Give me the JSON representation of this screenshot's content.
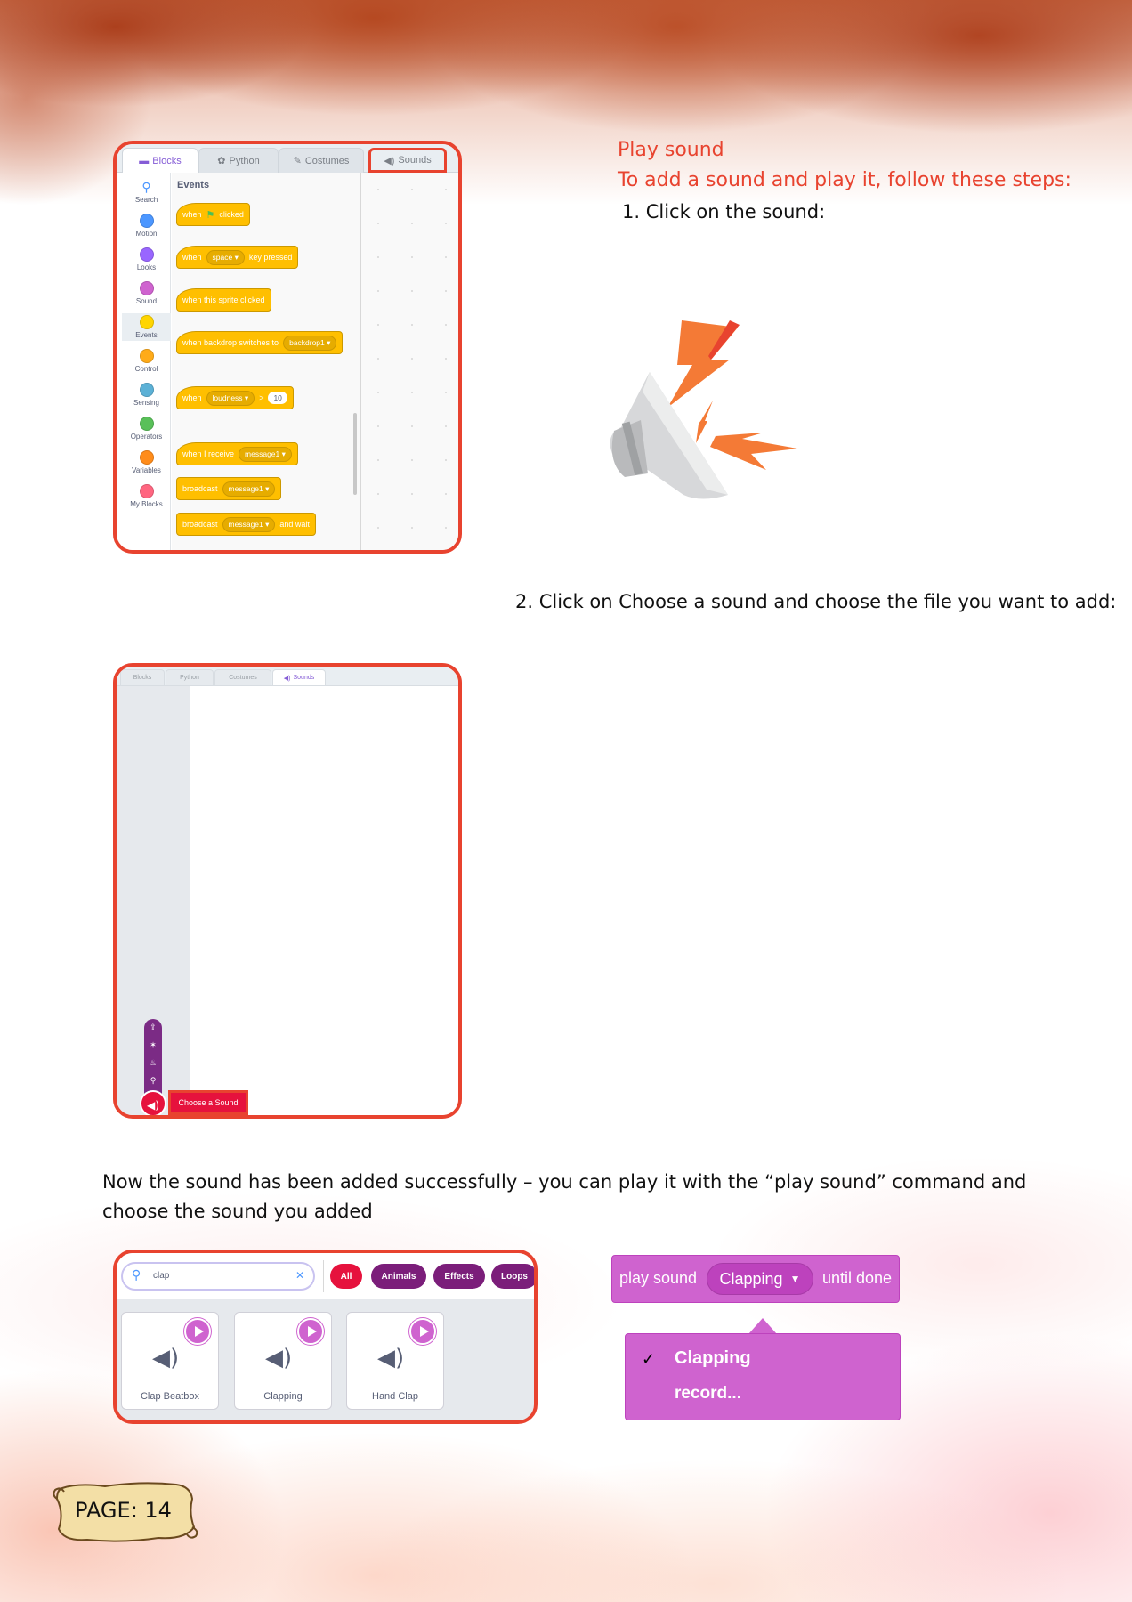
{
  "heading": {
    "title": "Play sound",
    "subtitle": "To add a sound and play it, follow these steps:"
  },
  "steps": {
    "step1": "1. Click on the sound:",
    "step2": "2. Click on Choose a sound and choose the file you want to add:"
  },
  "paragraph": {
    "line1": "Now the sound has been added successfully – you can play it with the “play sound” command and",
    "line2": "choose the sound you added"
  },
  "screenshot1": {
    "tabs": [
      "Blocks",
      "Python",
      "Costumes",
      "Sounds"
    ],
    "section_title": "Events",
    "categories": [
      {
        "label": "Search",
        "color": "#4c97ff"
      },
      {
        "label": "Motion",
        "color": "#4c97ff"
      },
      {
        "label": "Looks",
        "color": "#9966ff"
      },
      {
        "label": "Sound",
        "color": "#cf63cf"
      },
      {
        "label": "Events",
        "color": "#ffd500"
      },
      {
        "label": "Control",
        "color": "#ffab19"
      },
      {
        "label": "Sensing",
        "color": "#5cb1d6"
      },
      {
        "label": "Operators",
        "color": "#59c059"
      },
      {
        "label": "Variables",
        "color": "#ff8c1a"
      },
      {
        "label": "My Blocks",
        "color": "#ff6680"
      }
    ],
    "blocks": {
      "when": "when",
      "clicked": "clicked",
      "space": "space",
      "key_pressed": "key pressed",
      "sprite_clicked": "when this sprite clicked",
      "backdrop_switches": "when backdrop switches to",
      "backdrop1": "backdrop1",
      "loudness": "loudness",
      "gt": ">",
      "ten": "10",
      "receive": "when I receive",
      "message1": "message1",
      "broadcast": "broadcast",
      "and_wait": "and wait"
    }
  },
  "screenshot2": {
    "tabs": [
      "Blocks",
      "Python",
      "Costumes",
      "Sounds"
    ],
    "choose_button": "Choose a Sound"
  },
  "screenshot3": {
    "search_value": "clap",
    "chips": [
      {
        "label": "All",
        "color": "#e6123d"
      },
      {
        "label": "Animals",
        "color": "#7b1e7a"
      },
      {
        "label": "Effects",
        "color": "#7b1e7a"
      },
      {
        "label": "Loops",
        "color": "#7b1e7a"
      }
    ],
    "sounds": [
      "Clap Beatbox",
      "Clapping",
      "Hand Clap"
    ]
  },
  "play_sound_block": {
    "prefix": "play sound",
    "selected": "Clapping",
    "suffix": "until done",
    "menu": [
      "Clapping",
      "record..."
    ]
  },
  "page_label": "PAGE: 14"
}
